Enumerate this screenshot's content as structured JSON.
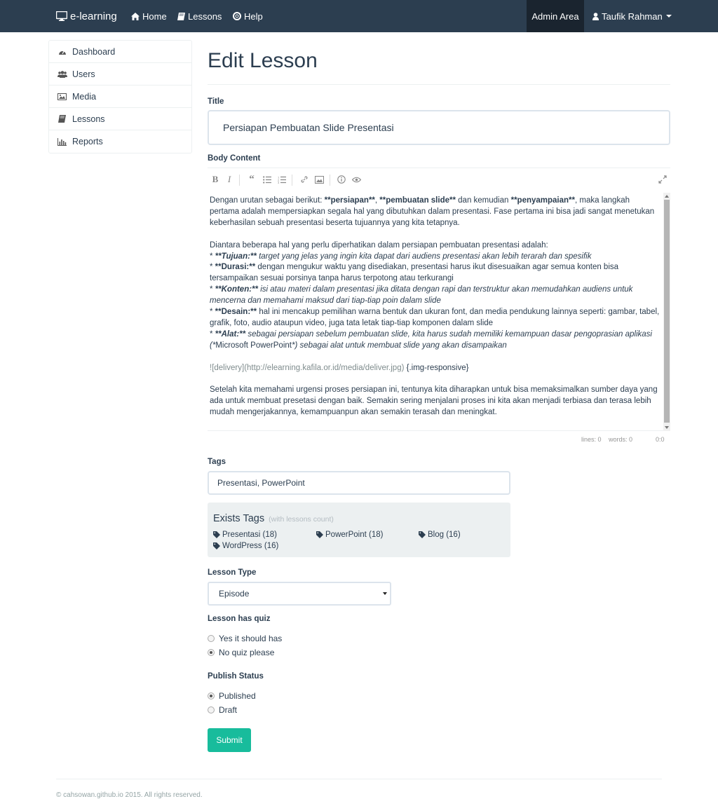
{
  "navbar": {
    "brand": "e-learning",
    "links": [
      "Home",
      "Lessons",
      "Help"
    ],
    "admin_area": "Admin Area",
    "user_name": "Taufik Rahman"
  },
  "sidebar": {
    "items": [
      {
        "label": "Dashboard",
        "icon": "dashboard-icon"
      },
      {
        "label": "Users",
        "icon": "users-icon"
      },
      {
        "label": "Media",
        "icon": "image-icon"
      },
      {
        "label": "Lessons",
        "icon": "book-icon"
      },
      {
        "label": "Reports",
        "icon": "bar-chart-icon"
      }
    ]
  },
  "page": {
    "title": "Edit Lesson"
  },
  "form": {
    "title_label": "Title",
    "title_value": "Persiapan Pembuatan Slide Presentasi",
    "body_label": "Body Content",
    "editor": {
      "p1": {
        "a": "Dengan urutan sebagai berikut: ",
        "b1": "**persiapan**",
        "c": ", ",
        "b2": "**pembuatan slide**",
        "d": " dan kemudian ",
        "b3": "**penyampaian**",
        "e": ", maka langkah pertama adalah mempersiapkan segala hal yang dibutuhkan dalam presentasi. Fase pertama ini bisa jadi sangat menetukan keberhasilan sebuah presentasi beserta tujuannya yang kita tetapnya."
      },
      "p2": "Diantara beberapa hal yang perlu diperhatikan dalam persiapan pembuatan presentasi adalah:",
      "bullets": [
        {
          "star": "* ",
          "key": "**Tujuan:**",
          "text": " target yang jelas yang ingin kita dapat dari audiens presentasi akan lebih terarah dan spesifik",
          "italic": true
        },
        {
          "star": "* ",
          "key": "**Durasi:**",
          "text": " dengan mengukur waktu yang disediakan, presentasi harus ikut disesuaikan agar semua konten bisa tersampaikan sesuai porsinya tanpa harus terpotong atau terkurangi",
          "italic": false
        },
        {
          "star": "* ",
          "key": "**Konten:**",
          "text": " isi atau materi dalam presentasi jika ditata dengan rapi dan terstruktur akan memudahkan audiens untuk mencerna dan memahami maksud dari tiap-tiap poin dalam slide",
          "italic": true
        },
        {
          "star": "* ",
          "key": "**Desain:**",
          "text": " hal ini mencakup pemilihan warna bentuk dan ukuran font, dan media pendukung lainnya seperti: gambar, tabel, grafik, foto, audio ataupun video,  juga tata letak tiap-tiap komponen dalam slide",
          "italic": false
        },
        {
          "star": "* ",
          "key": "**Alat:**",
          "text_a": " sebagai persiapan sebelum pembuatan slide, kita harus sudah memiliki kemampuan dasar pengoprasian aplikasi (*",
          "text_b": "Microsoft PowerPoint",
          "text_c": "*) sebagai alat untuk membuat slide yang akan disampaikan",
          "italic": true
        }
      ],
      "image_md": "![delivery](http://elearning.kafila.or.id/media/deliver.jpg)",
      "image_attr": " {.img-responsive}",
      "p3": "Setelah kita memahami urgensi proses persiapan ini, tentunya kita diharapkan untuk bisa memaksimalkan sumber daya yang ada untuk membuat presetasi dengan baik. Semakin sering menjalani proses ini kita akan menjadi terbiasa dan terasa lebih mudah mengerjakannya, kemampuanpun akan semakin terasah dan meningkat.",
      "status": {
        "lines": "lines: 0",
        "words": "words: 0",
        "cursor": "0:0"
      }
    },
    "tags_label": "Tags",
    "tags_value": "Presentasi, PowerPoint",
    "exists_tags": {
      "heading": "Exists Tags",
      "sub": "(with lessons count)",
      "tags": [
        "Presentasi (18)",
        "PowerPoint (18)",
        "Blog (16)",
        "WordPress (16)"
      ]
    },
    "lesson_type_label": "Lesson Type",
    "lesson_type_value": "Episode",
    "quiz_label": "Lesson has quiz",
    "quiz_options": [
      "Yes it should has",
      "No quiz please"
    ],
    "quiz_selected": 1,
    "publish_label": "Publish Status",
    "publish_options": [
      "Published",
      "Draft"
    ],
    "publish_selected": 0,
    "submit_label": "Submit"
  },
  "footer": {
    "text": "© cahsowan.github.io 2015. All rights reserved."
  },
  "colors": {
    "navbar": "#2c3e50",
    "admin_active": "#1a242f",
    "accent": "#18bc9c",
    "panel": "#ecf0f1"
  }
}
